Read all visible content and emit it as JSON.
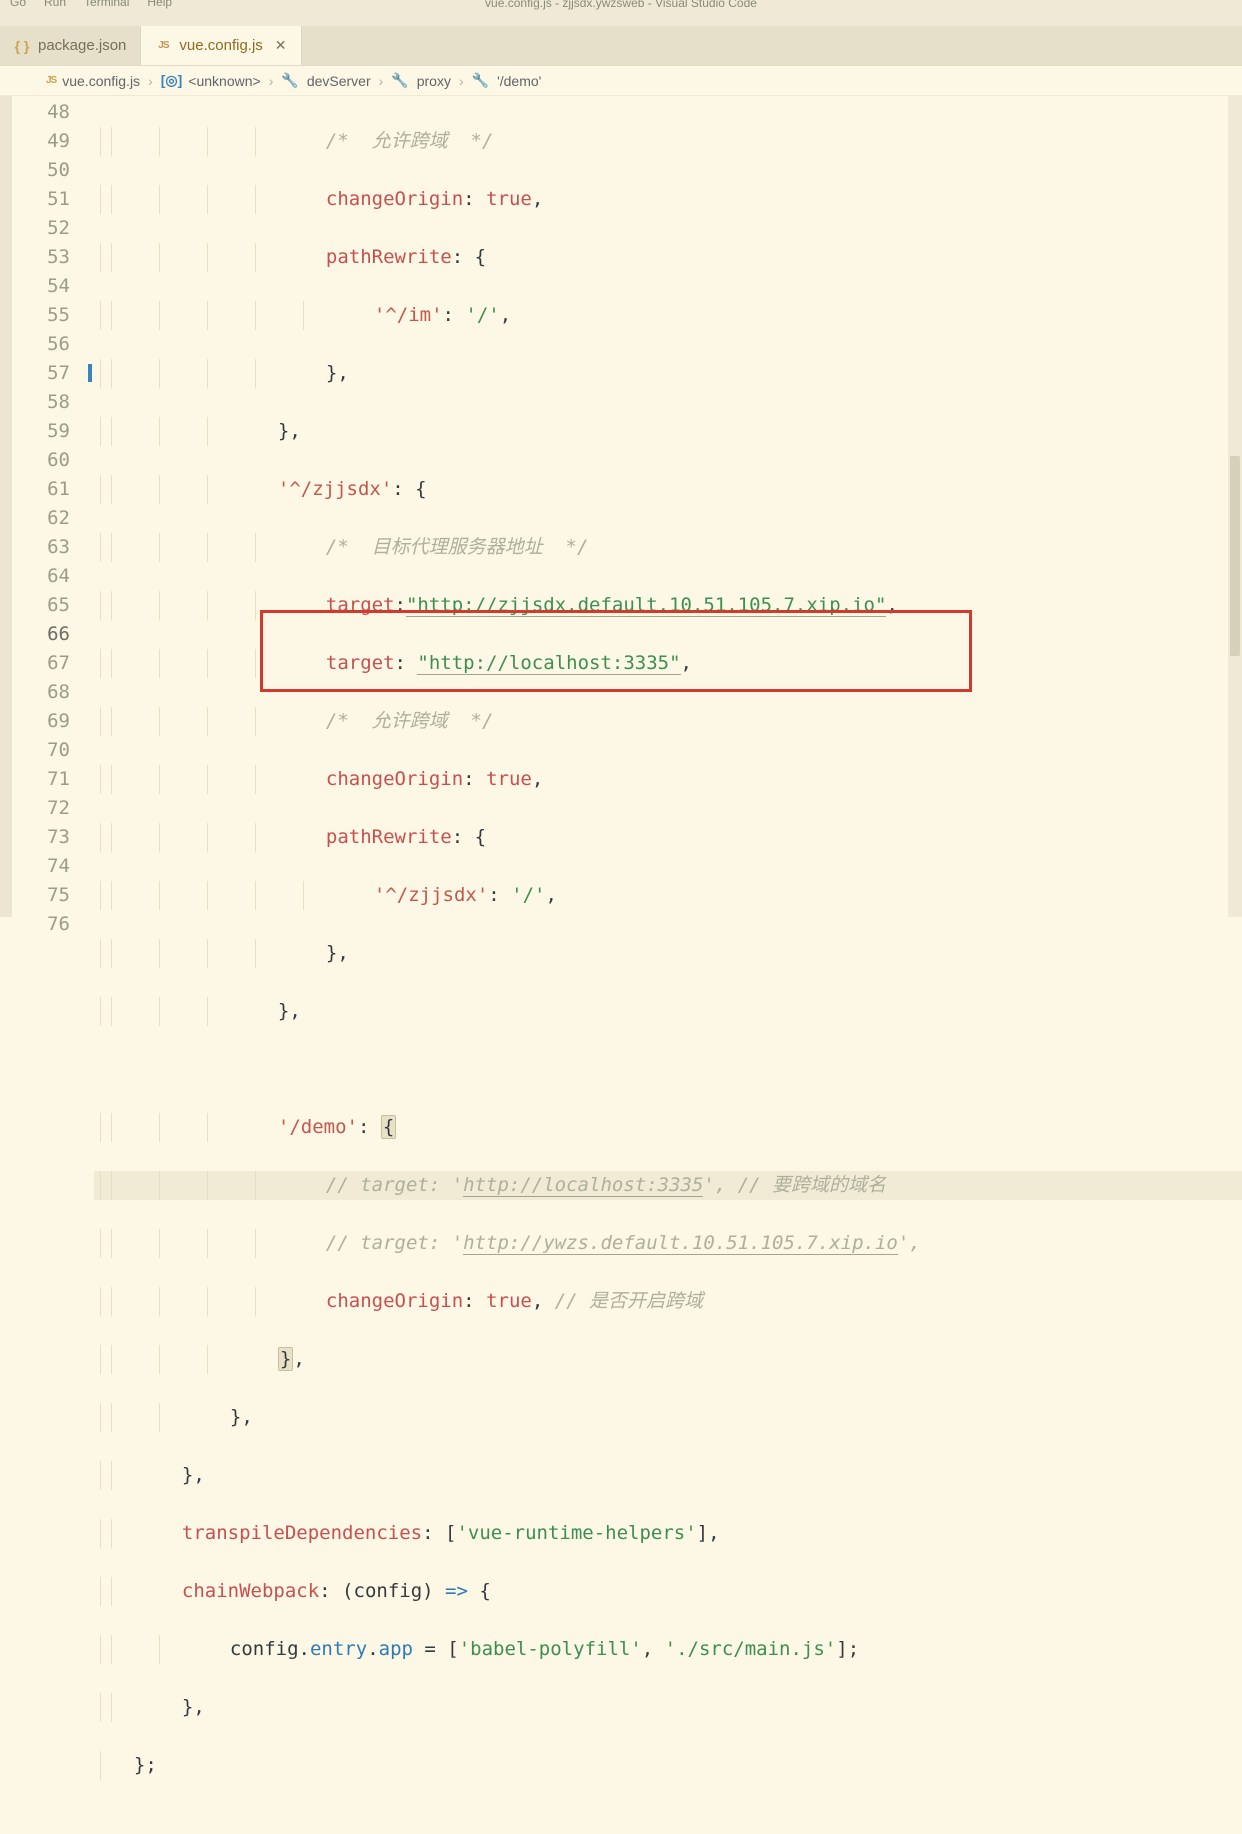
{
  "menu": {
    "go": "Go",
    "run": "Run",
    "terminal": "Terminal",
    "help": "Help"
  },
  "window_title": "vue.config.js - zjjsdx.ywzsweb - Visual Studio Code",
  "tabs": [
    {
      "label": "package.json",
      "icon": "json",
      "active": false,
      "close": false
    },
    {
      "label": "vue.config.js",
      "icon": "js",
      "active": true,
      "close": true
    }
  ],
  "breadcrumbs": {
    "file": "vue.config.js",
    "b1": "<unknown>",
    "b2": "devServer",
    "b3": "proxy",
    "b4": "'/demo'"
  },
  "first_ln": 48,
  "marked_ln": 57,
  "current_ln": 66,
  "lines": {
    "l48": {
      "indent": 7,
      "comment_tail": "/*  允许跨域  */"
    },
    "l49": {
      "prop": "changeOrigin",
      "val_bool": "true"
    },
    "l50": {
      "prop": "pathRewrite"
    },
    "l51": {
      "key": "'^/im'",
      "val": "'/'"
    },
    "l52": {},
    "l53": {},
    "l54": {
      "key": "'^/zjjsdx'"
    },
    "l55": {
      "comment": "/*  目标代理服务器地址  */"
    },
    "l56": {
      "prop": "target",
      "str": "\"http://zjjsdx.default.10.51.105.7.xip.io\""
    },
    "l57": {
      "prop": "target",
      "str": "\"http://localhost:3335\""
    },
    "l58": {
      "comment": "/*  允许跨域  */"
    },
    "l59": {
      "prop": "changeOrigin",
      "val_bool": "true"
    },
    "l60": {
      "prop": "pathRewrite"
    },
    "l61": {
      "key": "'^/zjjsdx'",
      "val": "'/'"
    },
    "l62": {},
    "l63": {},
    "l64": {},
    "l65": {
      "key": "'/demo'"
    },
    "l66": {
      "comment_pre": "// target: '",
      "link": "http://localhost:3335",
      "comment_post": "', // 要跨域的域名"
    },
    "l67": {
      "comment_pre": "// target: '",
      "link": "http://ywzs.default.10.51.105.7.xip.io",
      "comment_post": "',"
    },
    "l68": {
      "prop": "changeOrigin",
      "val_bool": "true",
      "tail_comment": "// 是否开启跨域"
    },
    "l69": {},
    "l70": {},
    "l71": {},
    "l72": {
      "prop": "transpileDependencies",
      "arr": "'vue-runtime-helpers'"
    },
    "l73": {
      "prop": "chainWebpack",
      "param": "config"
    },
    "l74": {
      "obj": "config",
      "m1": "entry",
      "m2": "app",
      "a": "'babel-polyfill'",
      "b": "'./src/main.js'"
    },
    "l75": {},
    "l76": {}
  }
}
